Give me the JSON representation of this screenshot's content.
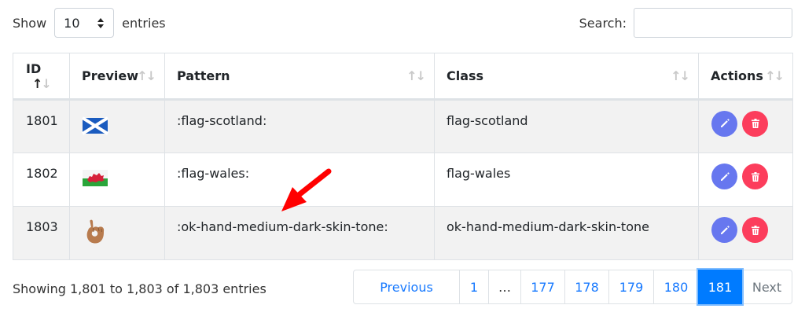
{
  "length_control": {
    "show_label": "Show",
    "value": "10",
    "entries_label": "entries"
  },
  "search": {
    "label": "Search:",
    "value": "",
    "placeholder": ""
  },
  "columns": [
    {
      "label": "ID",
      "sort": "asc"
    },
    {
      "label": "Preview",
      "sort": "none"
    },
    {
      "label": "Pattern",
      "sort": "none"
    },
    {
      "label": "Class",
      "sort": "none"
    },
    {
      "label": "Actions",
      "sort": "none"
    }
  ],
  "rows": [
    {
      "id": "1801",
      "preview_icon": "flag-scotland-icon",
      "pattern": ":flag-scotland:",
      "class": "flag-scotland"
    },
    {
      "id": "1802",
      "preview_icon": "flag-wales-icon",
      "pattern": ":flag-wales:",
      "class": "flag-wales"
    },
    {
      "id": "1803",
      "preview_icon": "ok-hand-dark-skin-tone-icon",
      "pattern": ":ok-hand-medium-dark-skin-tone:",
      "class": "ok-hand-medium-dark-skin-tone"
    }
  ],
  "row_actions": {
    "edit_icon": "pencil-icon",
    "delete_icon": "trash-icon"
  },
  "info_text": "Showing 1,801 to 1,803 of 1,803 entries",
  "pagination": {
    "previous_label": "Previous",
    "next_label": "Next",
    "pages": [
      "1",
      "…",
      "177",
      "178",
      "179",
      "180",
      "181"
    ],
    "active_page": "181"
  },
  "colors": {
    "edit_button": "#6777ef",
    "delete_button": "#fc3d5c",
    "pagination_link": "#1779ff",
    "pagination_active": "#007bff",
    "annotation_arrow": "#ff0000"
  }
}
